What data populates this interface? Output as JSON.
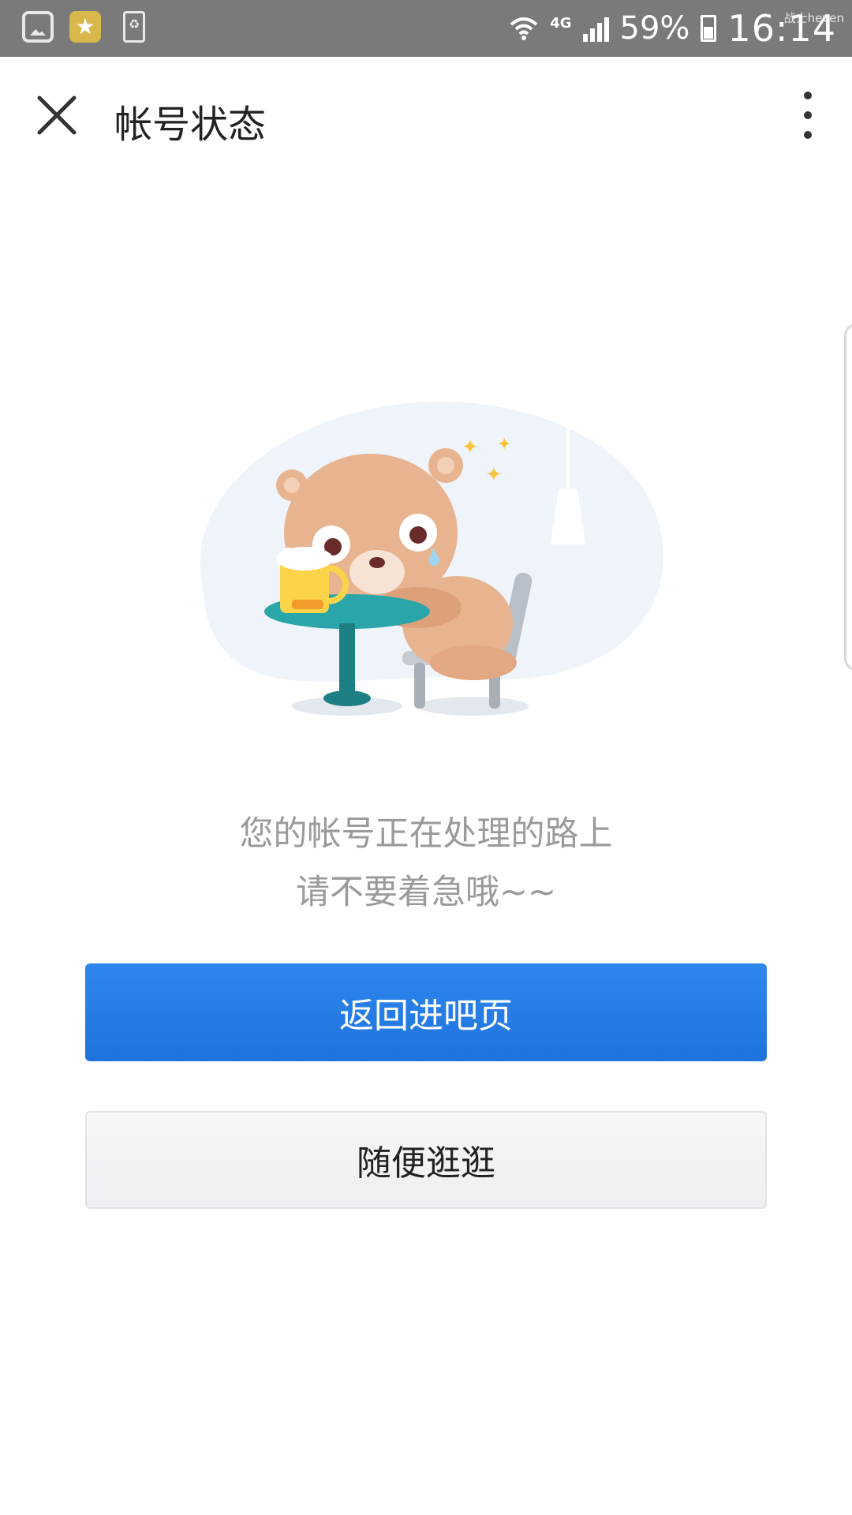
{
  "status_bar": {
    "network": "4G",
    "battery_percent": "59%",
    "time": "16:14",
    "watermark": "战士heven",
    "left_icons": [
      "gallery-icon",
      "qq-icon",
      "battery-saver-icon"
    ]
  },
  "header": {
    "title": "帐号状态",
    "close_icon": "close-icon",
    "more_icon": "more-vertical-icon"
  },
  "message": {
    "line1": "您的帐号正在处理的路上",
    "line2": "请不要着急哦~~"
  },
  "buttons": {
    "primary": "返回进吧页",
    "secondary": "随便逛逛"
  },
  "colors": {
    "primary": "#2a7de8",
    "status_bar": "#7a7a7a",
    "message_text": "#9a9a9a"
  }
}
